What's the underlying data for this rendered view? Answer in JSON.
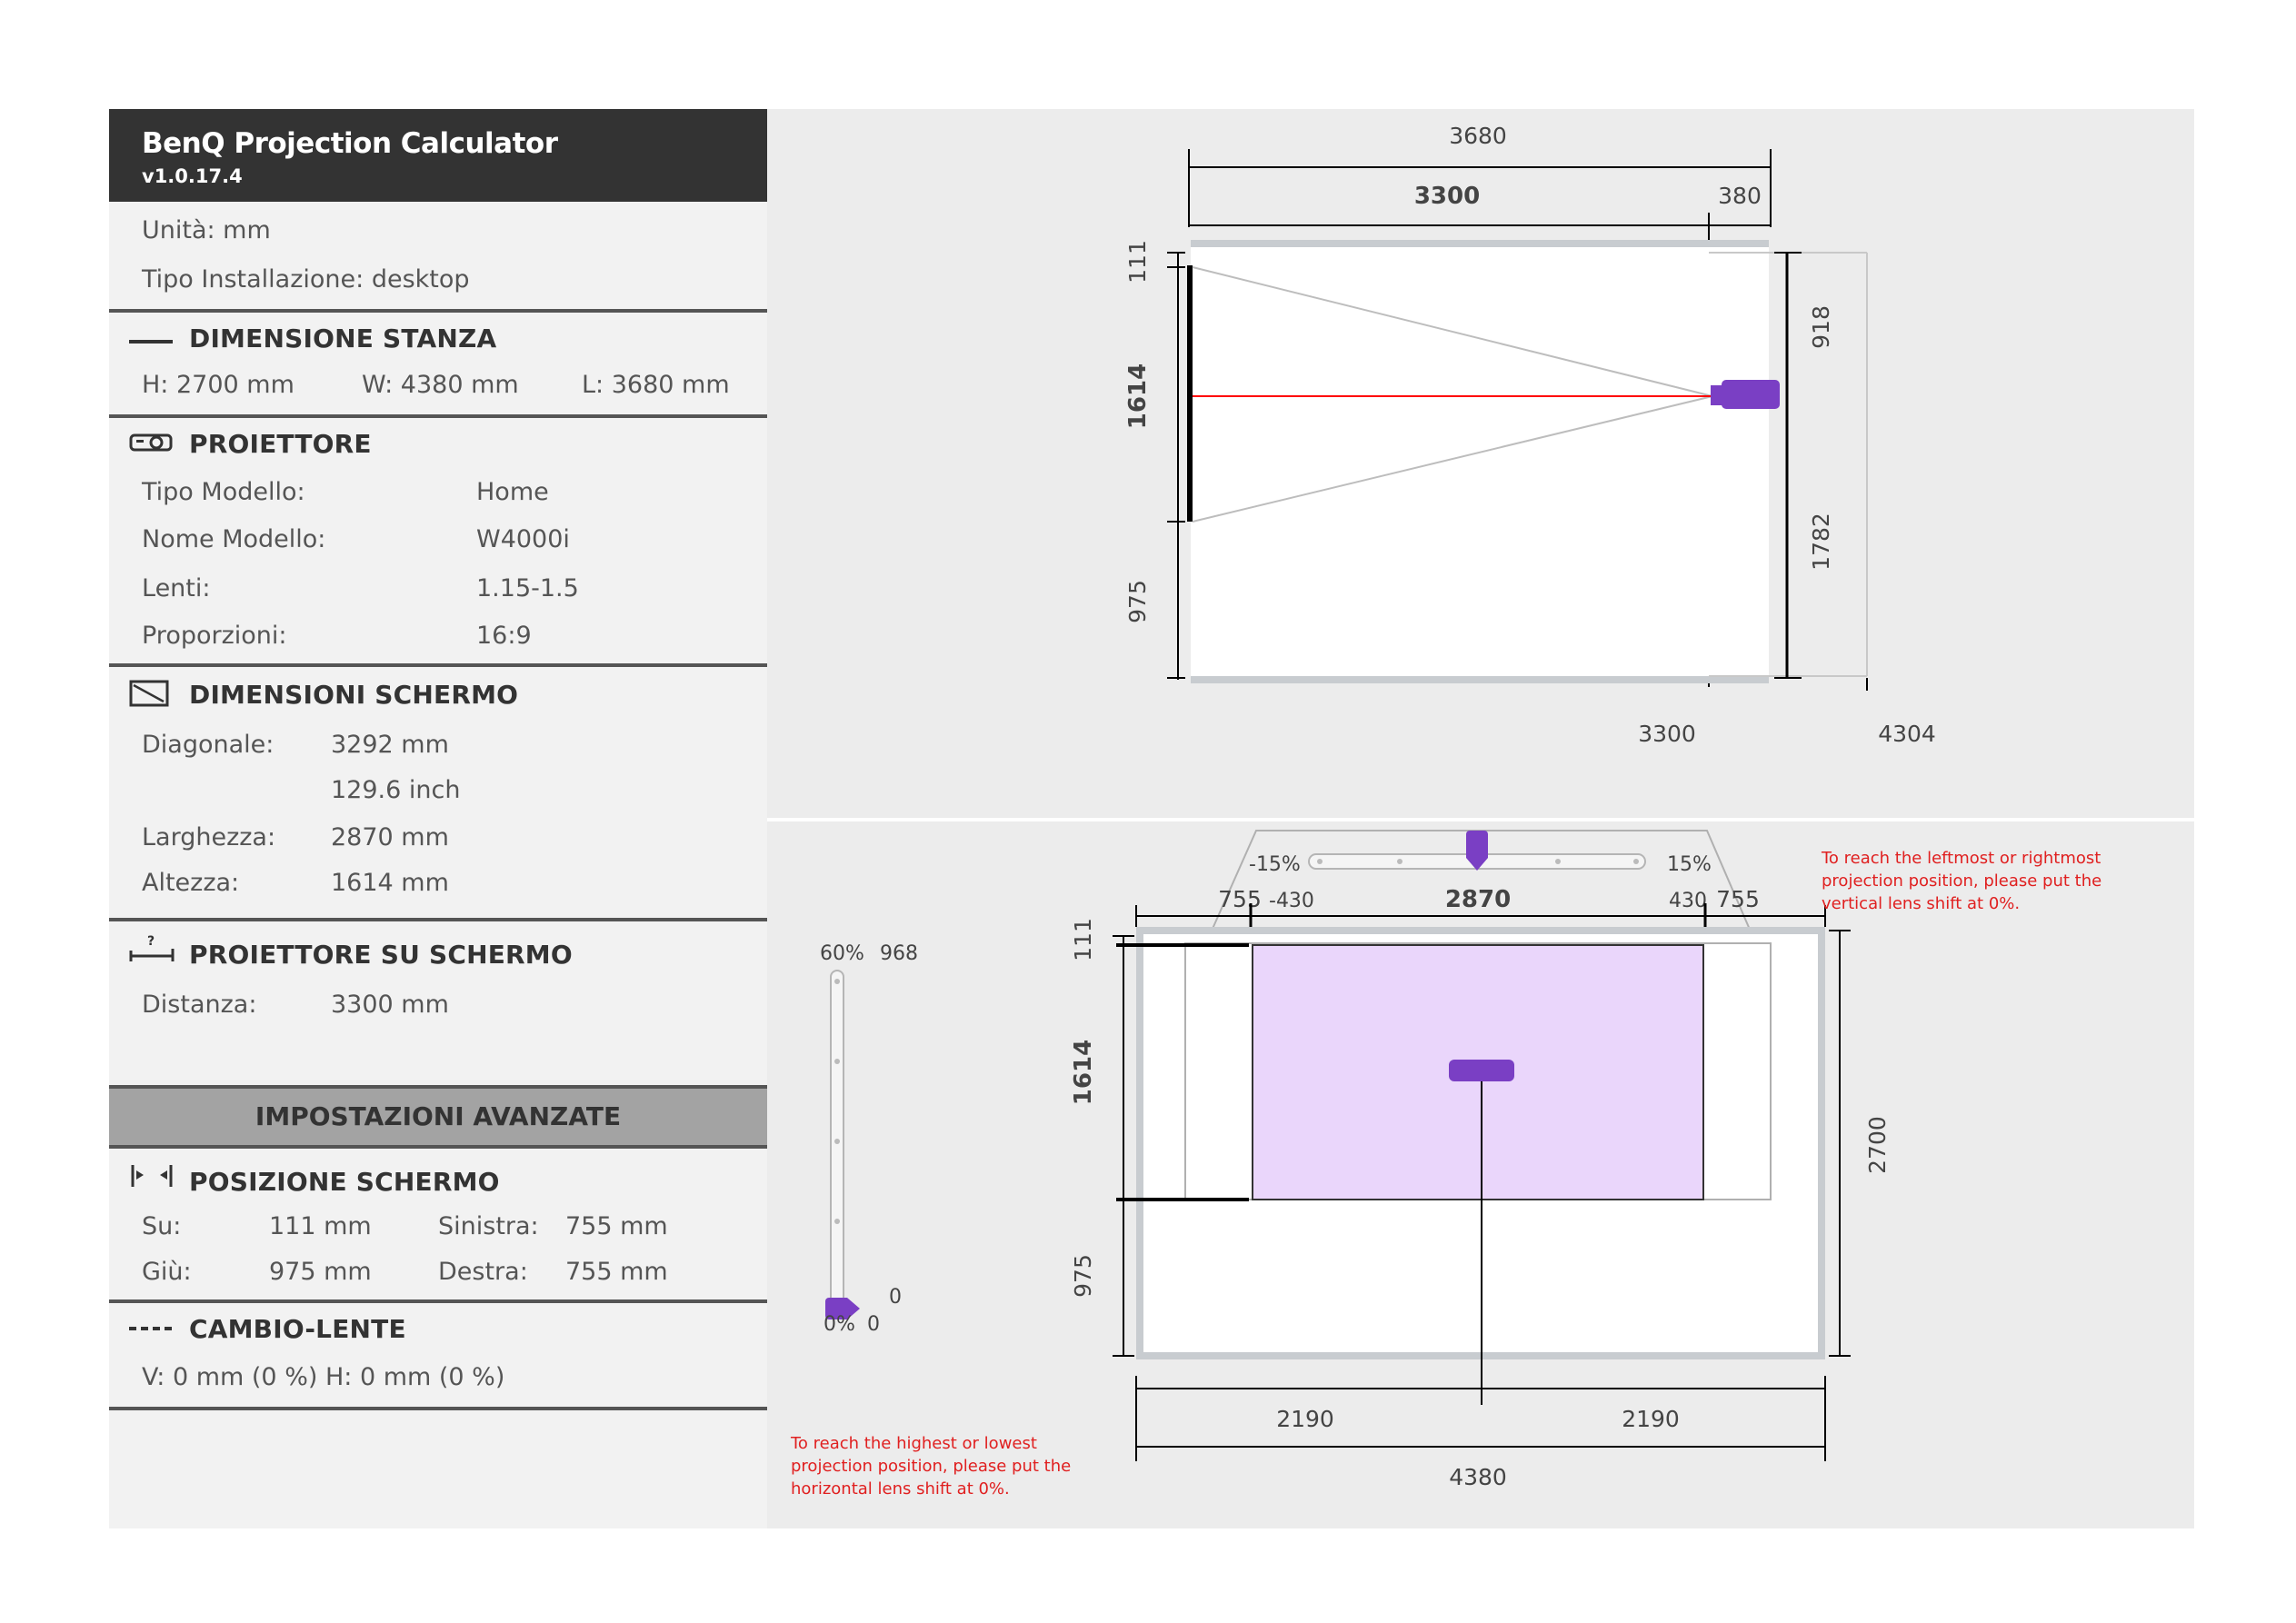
{
  "app": {
    "title": "BenQ Projection Calculator",
    "version": "v1.0.17.4"
  },
  "general": {
    "units": "Unità: mm",
    "install_type": "Tipo Installazione: desktop"
  },
  "room": {
    "title": "DIMENSIONE STANZA",
    "h": "H: 2700 mm",
    "w": "W: 4380 mm",
    "l": "L: 3680 mm"
  },
  "projector": {
    "title": "PROIETTORE",
    "rows": [
      {
        "label": "Tipo Modello:",
        "value": "Home"
      },
      {
        "label": "Nome Modello:",
        "value": "W4000i"
      },
      {
        "label": "Lenti:",
        "value": "1.15-1.5"
      },
      {
        "label": "Proporzioni:",
        "value": "16:9"
      }
    ]
  },
  "screen": {
    "title": "DIMENSIONI SCHERMO",
    "diagonal_label": "Diagonale:",
    "diagonal_mm": "3292 mm",
    "diagonal_inch": "129.6 inch",
    "width_label": "Larghezza:",
    "width": "2870 mm",
    "height_label": "Altezza:",
    "height": "1614 mm"
  },
  "throw": {
    "title": "PROIETTORE SU SCHERMO",
    "distance_label": "Distanza:",
    "distance": "3300 mm"
  },
  "advanced": {
    "label": "IMPOSTAZIONI AVANZATE"
  },
  "position": {
    "title": "POSIZIONE SCHERMO",
    "up_label": "Su:",
    "up": "111 mm",
    "left_label": "Sinistra:",
    "left": "755 mm",
    "down_label": "Giù:",
    "down": "975 mm",
    "right_label": "Destra:",
    "right": "755 mm"
  },
  "lens_shift": {
    "title": "CAMBIO-LENTE",
    "value": "V: 0 mm (0 %)  H: 0 mm (0 %)"
  },
  "side_view": {
    "total_length": "3680",
    "throw": "3300",
    "behind": "380",
    "top": "111",
    "screen_h": "1614",
    "bottom": "975",
    "proj_top": "918",
    "proj_bottom": "1782",
    "base_throw": "3300",
    "base_far": "4304"
  },
  "front_view": {
    "h_shift_min_pct": "-15%",
    "h_shift_max_pct": "15%",
    "h_shift_min_mm": "-430",
    "h_shift_max_mm": "430",
    "left_margin": "755",
    "right_margin": "755",
    "screen_w": "2870",
    "top": "111",
    "screen_h": "1614",
    "bottom": "975",
    "room_h": "2700",
    "half_left": "2190",
    "half_right": "2190",
    "room_w": "4380",
    "v_shift_max_pct": "60%",
    "v_shift_max_mm": "968",
    "v_shift_min_pct": "0%",
    "v_shift_min_mm": "0",
    "v_shift_value": "0",
    "h_shift_value_pct": 0,
    "v_shift_value_pct": 0
  },
  "notes": {
    "horizontal": "To reach the leftmost or rightmost projection position, please put the vertical lens shift at 0%.",
    "vertical": "To reach the highest or lowest projection position, please put the horizontal lens shift at 0%."
  },
  "colors": {
    "accent": "#7a3fc4",
    "beam": "#ff0000",
    "screen_fill": "#ead6fb",
    "note": "#e02020",
    "header": "#333333"
  }
}
